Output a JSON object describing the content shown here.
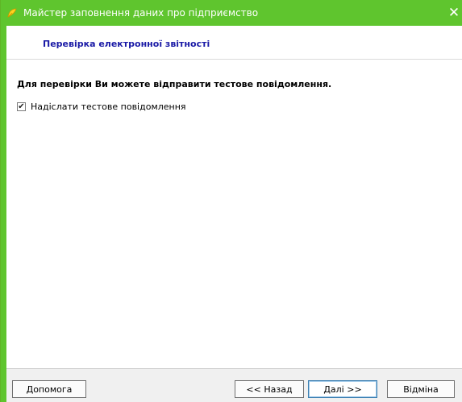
{
  "window": {
    "title": "Майстер заповнення даних про підприємство",
    "close_glyph": "✕"
  },
  "colors": {
    "titlebar": "#5fc52e",
    "header_title": "#1a1aa6"
  },
  "icons": {
    "app": "app-icon",
    "close": "close-icon",
    "checkmark": "checkmark-icon"
  },
  "page": {
    "header_title": "Перевірка електронної звітності",
    "prompt": "Для перевірки Ви можете відправити тестове повідомлення.",
    "checkbox": {
      "label": "Надіслати тестове повідомлення",
      "checked": true,
      "check_glyph": "✔"
    }
  },
  "footer": {
    "help_label": "Допомога",
    "back_label": "<< Назад",
    "next_label": "Далі >>",
    "cancel_label": "Відміна"
  }
}
